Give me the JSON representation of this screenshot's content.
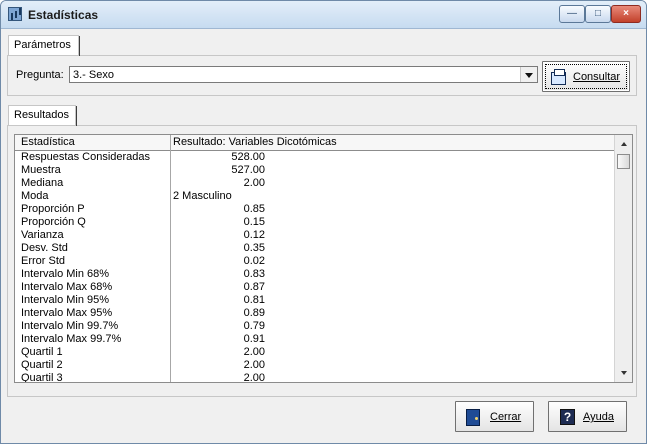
{
  "window": {
    "title": "Estadísticas"
  },
  "parameters": {
    "tab": "Parámetros",
    "question_label": "Pregunta:",
    "question_value": "3.- Sexo",
    "consult_button": "Consultar"
  },
  "results": {
    "tab": "Resultados",
    "headers": [
      "Estadística",
      "Resultado: Variables Dicotómicas"
    ],
    "rows": [
      [
        "Respuestas Consideradas",
        "528.00"
      ],
      [
        "Muestra",
        "527.00"
      ],
      [
        "Mediana",
        "2.00"
      ],
      [
        "Moda",
        "2 Masculino"
      ],
      [
        "Proporción P",
        "0.85"
      ],
      [
        "Proporción Q",
        "0.15"
      ],
      [
        "Varianza",
        "0.12"
      ],
      [
        "Desv. Std",
        "0.35"
      ],
      [
        "Error Std",
        "0.02"
      ],
      [
        "Intervalo Min 68%",
        "0.83"
      ],
      [
        "Intervalo Max 68%",
        "0.87"
      ],
      [
        "Intervalo Min 95%",
        "0.81"
      ],
      [
        "Intervalo Max 95%",
        "0.89"
      ],
      [
        "Intervalo Min 99.7%",
        "0.79"
      ],
      [
        "Intervalo Max 99.7%",
        "0.91"
      ],
      [
        "Quartil 1",
        "2.00"
      ],
      [
        "Quartil 2",
        "2.00"
      ],
      [
        "Quartil 3",
        "2.00"
      ]
    ]
  },
  "buttons": {
    "close": "Cerrar",
    "help": "Ayuda"
  },
  "icons": {
    "app": "statistics-window-icon",
    "consult": "printer-icon",
    "close": "exit-door-icon",
    "help": "help-icon"
  }
}
